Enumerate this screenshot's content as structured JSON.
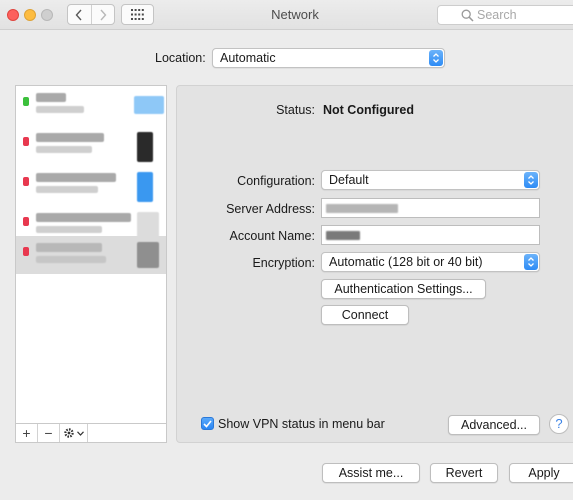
{
  "window": {
    "title": "Network",
    "search_placeholder": "Search"
  },
  "location": {
    "label": "Location:",
    "value": "Automatic"
  },
  "sidebar": {
    "services": [
      {
        "status": "green",
        "status_color": "#3cc03c",
        "icon": "network-service-icon",
        "icon_color": "#7cc0f5"
      },
      {
        "status": "red",
        "status_color": "#e8384f",
        "icon": "network-service-icon",
        "icon_color": "#2a2a2a"
      },
      {
        "status": "red",
        "status_color": "#e8384f",
        "icon": "network-service-icon",
        "icon_color": "#3a98f0"
      },
      {
        "status": "red",
        "status_color": "#e8384f",
        "icon": "network-service-icon",
        "icon_color": "#d8d8d8"
      },
      {
        "status": "red",
        "status_color": "#e8384f",
        "icon": "network-service-icon",
        "icon_color": "#8f8f8f",
        "selected": true
      }
    ],
    "add_label": "+",
    "remove_label": "−"
  },
  "detail": {
    "status_label": "Status:",
    "status_value": "Not Configured",
    "configuration_label": "Configuration:",
    "configuration_value": "Default",
    "server_address_label": "Server Address:",
    "account_name_label": "Account Name:",
    "encryption_label": "Encryption:",
    "encryption_value": "Automatic (128 bit or 40 bit)",
    "auth_settings_label": "Authentication Settings...",
    "connect_label": "Connect",
    "show_vpn_label": "Show VPN status in menu bar",
    "show_vpn_checked": true,
    "advanced_label": "Advanced...",
    "help_label": "?"
  },
  "footer": {
    "assist_label": "Assist me...",
    "revert_label": "Revert",
    "apply_label": "Apply"
  },
  "colors": {
    "accent": "#2d8bf5",
    "status_green": "#3cc03c",
    "status_red": "#e8384f"
  }
}
